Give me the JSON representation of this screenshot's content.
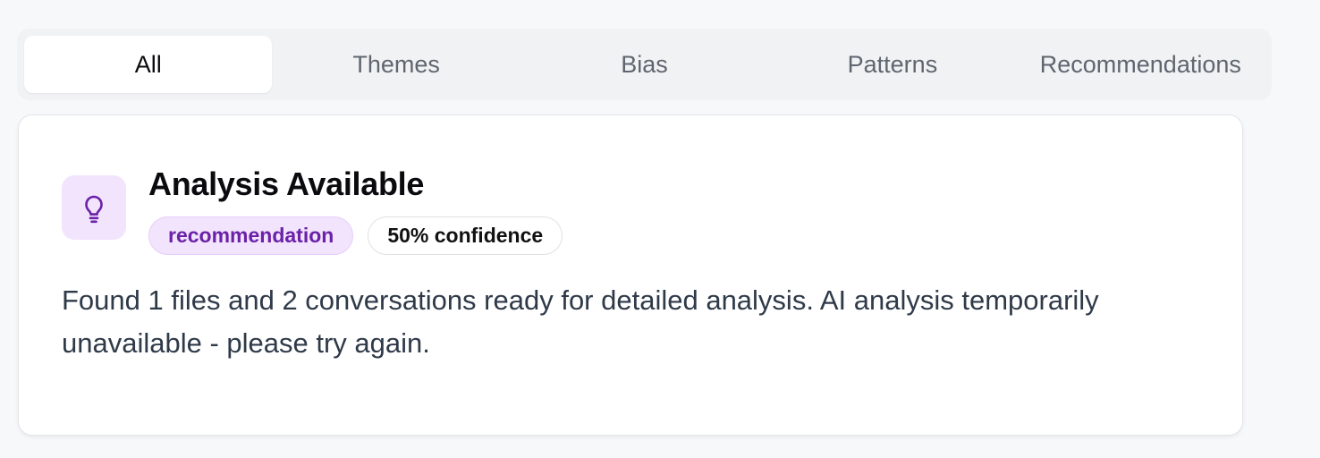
{
  "tabs": [
    {
      "label": "All",
      "active": true
    },
    {
      "label": "Themes",
      "active": false
    },
    {
      "label": "Bias",
      "active": false
    },
    {
      "label": "Patterns",
      "active": false
    },
    {
      "label": "Recommendations",
      "active": false
    }
  ],
  "insight_card": {
    "icon": "lightbulb-icon",
    "title": "Analysis Available",
    "type_badge": "recommendation",
    "confidence_badge": "50% confidence",
    "description": "Found 1 files and 2 conversations ready for detailed analysis. AI analysis temporarily unavailable - please try again."
  },
  "colors": {
    "accent_purple": "#6b21a8",
    "badge_purple_bg": "#f1e4fc",
    "page_bg": "#f7f8fa"
  }
}
